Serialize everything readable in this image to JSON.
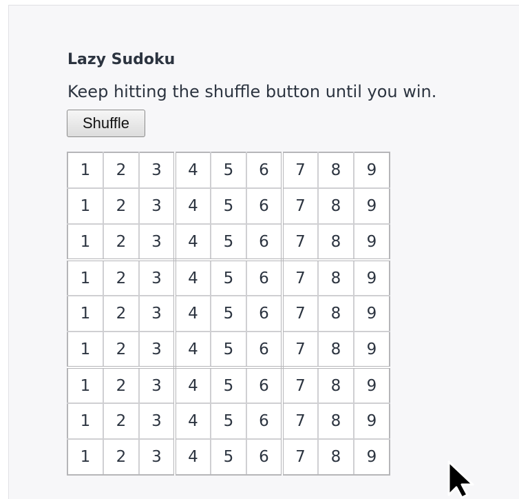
{
  "app": {
    "title": "Lazy Sudoku",
    "description": "Keep hitting the shuffle button until you win.",
    "shuffle_label": "Shuffle"
  },
  "board": {
    "rows": [
      [
        "1",
        "2",
        "3",
        "4",
        "5",
        "6",
        "7",
        "8",
        "9"
      ],
      [
        "1",
        "2",
        "3",
        "4",
        "5",
        "6",
        "7",
        "8",
        "9"
      ],
      [
        "1",
        "2",
        "3",
        "4",
        "5",
        "6",
        "7",
        "8",
        "9"
      ],
      [
        "1",
        "2",
        "3",
        "4",
        "5",
        "6",
        "7",
        "8",
        "9"
      ],
      [
        "1",
        "2",
        "3",
        "4",
        "5",
        "6",
        "7",
        "8",
        "9"
      ],
      [
        "1",
        "2",
        "3",
        "4",
        "5",
        "6",
        "7",
        "8",
        "9"
      ],
      [
        "1",
        "2",
        "3",
        "4",
        "5",
        "6",
        "7",
        "8",
        "9"
      ],
      [
        "1",
        "2",
        "3",
        "4",
        "5",
        "6",
        "7",
        "8",
        "9"
      ],
      [
        "1",
        "2",
        "3",
        "4",
        "5",
        "6",
        "7",
        "8",
        "9"
      ]
    ]
  },
  "icons": {
    "cursor": "mouse-pointer-icon"
  },
  "colors": {
    "text": "#2c3440",
    "panel_background": "#f7f7f9",
    "cell_border": "#cfcfd2",
    "box_border": "#b5b5b8"
  }
}
